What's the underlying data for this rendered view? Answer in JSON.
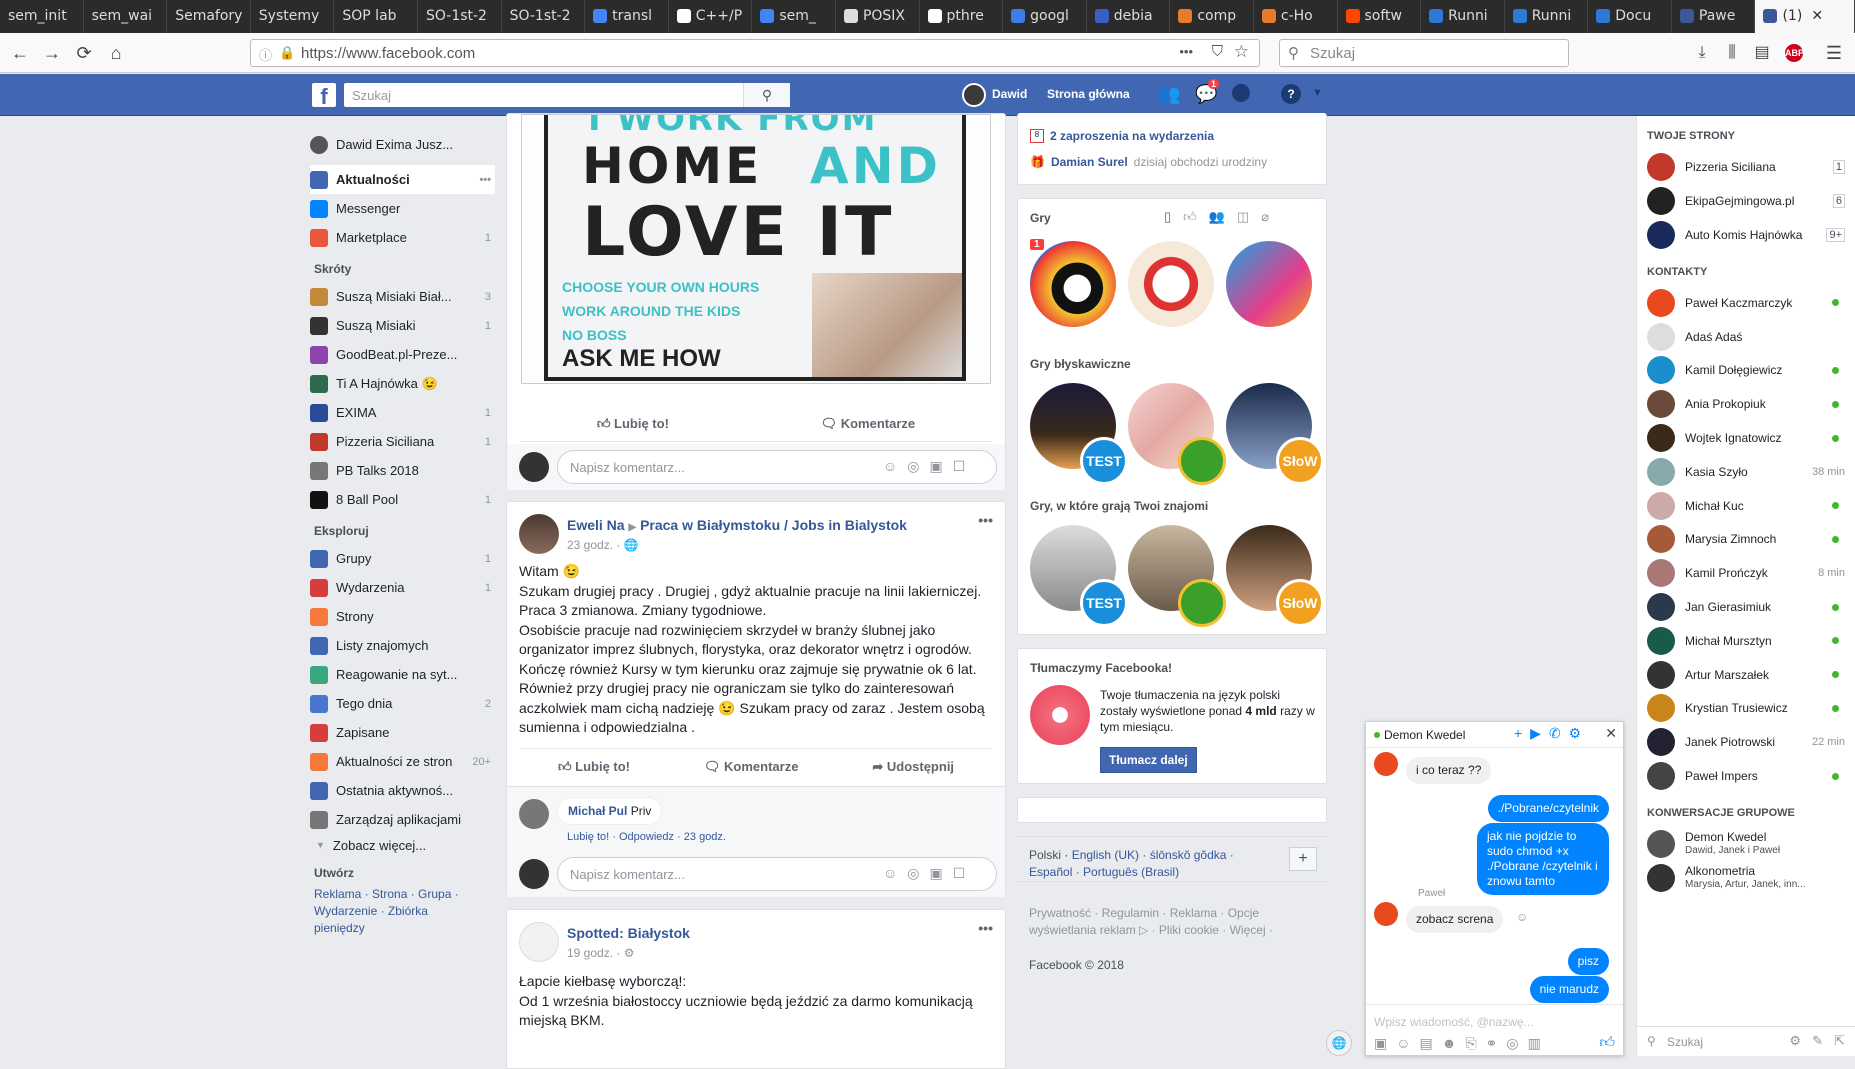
{
  "tabs": [
    {
      "label": "sem_init",
      "color": "#777"
    },
    {
      "label": "sem_wai",
      "color": "#777"
    },
    {
      "label": "Semafory",
      "color": "#777"
    },
    {
      "label": "Systemy",
      "color": "#777"
    },
    {
      "label": "SOP lab",
      "color": "#777"
    },
    {
      "label": "SO-1st-2",
      "color": "#777"
    },
    {
      "label": "SO-1st-2",
      "color": "#777"
    },
    {
      "label": "transl",
      "color": "#4285f4"
    },
    {
      "label": "C++/P",
      "color": "#fff"
    },
    {
      "label": "sem_",
      "color": "#4285f4"
    },
    {
      "label": "POSIX",
      "color": "#ddd"
    },
    {
      "label": "pthre",
      "color": "#fff"
    },
    {
      "label": "googl",
      "color": "#3f7ee8"
    },
    {
      "label": "debia",
      "color": "#3b5fc4"
    },
    {
      "label": "comp",
      "color": "#e87a2b"
    },
    {
      "label": "c-Ho",
      "color": "#e87a2b"
    },
    {
      "label": "softw",
      "color": "#ff4500"
    },
    {
      "label": "Runni",
      "color": "#2a7ad6"
    },
    {
      "label": "Runni",
      "color": "#2a7ad6"
    },
    {
      "label": "Docu",
      "color": "#2a7ad6"
    },
    {
      "label": "Pawe",
      "color": "#3b5998"
    }
  ],
  "active_tab": {
    "label": "(1)",
    "close": "✕"
  },
  "browser": {
    "url": "https://www.facebook.com",
    "search_placeholder": "Szukaj",
    "back": "←",
    "forward": "→",
    "reload": "⟳",
    "home": "⌂",
    "more": "•••",
    "star": "☆",
    "menu": "☰",
    "adblock_count": "1"
  },
  "fb": {
    "search_placeholder": "Szukaj",
    "logo": "f",
    "user": "Dawid",
    "home": "Strona główna",
    "msg_badge": "1",
    "left": {
      "profile": "Dawid Exima Jusz...",
      "items": [
        {
          "label": "Aktualności",
          "count": "•••",
          "color": "#4267b2"
        },
        {
          "label": "Messenger",
          "count": "",
          "color": "#0084ff"
        },
        {
          "label": "Marketplace",
          "count": "1",
          "color": "#e9573f"
        }
      ],
      "shortcuts_head": "Skróty",
      "shortcuts": [
        {
          "label": "Suszą Misiaki Biał...",
          "count": "3",
          "color": "#c48a3a"
        },
        {
          "label": "Suszą Misiaki",
          "count": "1",
          "color": "#333"
        },
        {
          "label": "GoodBeat.pl-Preze...",
          "count": "",
          "color": "#8e44ad"
        },
        {
          "label": "Ti A Hajnówka 😉",
          "count": "",
          "color": "#2d6a4f"
        },
        {
          "label": "EXIMA",
          "count": "1",
          "color": "#2a4a9a"
        },
        {
          "label": "Pizzeria Siciliana",
          "count": "1",
          "color": "#c0392b"
        },
        {
          "label": "PB Talks 2018",
          "count": "",
          "color": "#777"
        },
        {
          "label": "8 Ball Pool",
          "count": "1",
          "color": "#111"
        }
      ],
      "explore_head": "Eksploruj",
      "explore": [
        {
          "label": "Grupy",
          "count": "1",
          "color": "#4267b2"
        },
        {
          "label": "Wydarzenia",
          "count": "1",
          "color": "#d63d3d"
        },
        {
          "label": "Strony",
          "count": "",
          "color": "#f5793a"
        },
        {
          "label": "Listy znajomych",
          "count": "",
          "color": "#4267b2"
        },
        {
          "label": "Reagowanie na syt...",
          "count": "",
          "color": "#3aa77e"
        },
        {
          "label": "Tego dnia",
          "count": "2",
          "color": "#4a76d0"
        },
        {
          "label": "Zapisane",
          "count": "",
          "color": "#d63d3d"
        },
        {
          "label": "Aktualności ze stron",
          "count": "20+",
          "color": "#f5793a"
        },
        {
          "label": "Ostatnia aktywnoś...",
          "count": "",
          "color": "#4267b2"
        },
        {
          "label": "Zarządzaj aplikacjami",
          "count": "",
          "color": "#777"
        }
      ],
      "see_more": "Zobacz więcej...",
      "create_head": "Utwórz",
      "create_links": "Reklama · Strona · Grupa · Wydarzenie · Zbiórka pieniędzy"
    },
    "post1": {
      "img_line1": "I WORK FROM",
      "img_line2a": "HOME",
      "img_line2b": "AND",
      "img_line3": "LOVE IT",
      "img_small1": "CHOOSE YOUR OWN HOURS",
      "img_small2": "WORK AROUND THE KIDS",
      "img_small3": "NO BOSS",
      "img_cta": "ASK ME HOW",
      "like": "Lubię to!",
      "comment": "Komentarze",
      "comment_placeholder": "Napisz komentarz..."
    },
    "post2": {
      "author": "Eweli Na",
      "arrow": "▶",
      "group": "Praca w Białymstoku / Jobs in Bialystok",
      "time": "23 godz. · 🌐",
      "text1": "Witam 😉",
      "text2": "Szukam drugiej pracy . Drugiej , gdyż aktualnie pracuje na linii lakierniczej.",
      "text3": "Praca 3 zmianowa. Zmiany tygodniowe.",
      "text4": "Osobiście pracuje nad rozwinięciem skrzydeł w branży ślubnej jako",
      "text5": "organizator imprez ślubnych, florystyka, oraz dekorator wnętrz i ogrodów.",
      "text6": "Kończę również Kursy w tym kierunku oraz zajmuje się prywatnie ok 6 lat.",
      "text7": "Również przy drugiej pracy nie ograniczam sie tylko do zainteresowań",
      "text8": "aczkolwiek mam cichą nadzieję 😉 Szukam pracy od zaraz . Jestem osobą",
      "text9": "sumienna i odpowiedzialna .",
      "like": "Lubię to!",
      "comment": "Komentarze",
      "share": "Udostępnij",
      "c_author": "Michał Pul",
      "c_text": "Priv",
      "c_actions": "Lubię to! · Odpowiedz · 23 godz.",
      "comment_placeholder": "Napisz komentarz..."
    },
    "post3": {
      "author": "Spotted: Białystok",
      "time": "19 godz. · ⚙",
      "text1": "Łapcie kiełbasę wyborczą!:",
      "text2": "Od 1 września białostoccy uczniowie będą jeździć za darmo komunikacją",
      "text3": "miejską BKM."
    },
    "right": {
      "events": "2 zaproszenia na wydarzenia",
      "bday_name": "Damian Surel",
      "bday_text": "dzisiaj obchodzi urodziny",
      "games_head": "Gry",
      "games_badge": "1",
      "instant_head": "Gry błyskawiczne",
      "friends_games_head": "Gry, w które grają Twoi znajomi",
      "test": "TEST",
      "slow": "SłoW",
      "translate_head": "Tłumaczymy Facebooka!",
      "translate_text1": "Twoje tłumaczenia na język polski",
      "translate_text2": "zostały wyświetlone ponad",
      "translate_bold": "4 mld",
      "translate_text3": "razy w tym miesiącu.",
      "translate_btn": "Tłumacz dalej",
      "langs_current": "Polski",
      "langs": "English (UK) · ślōnskŏ gŏdka · Español · Português (Brasil)",
      "plus": "+",
      "footer": "Prywatność · Regulamin · Reklama · Opcje wyświetlania reklam ▷ · Pliki cookie · Więcej ·",
      "copyright": "Facebook © 2018"
    },
    "sidebar": {
      "pages_head": "TWOJE STRONY",
      "pages": [
        {
          "name": "Pizzeria Siciliana",
          "count": "1",
          "color": "#c0392b"
        },
        {
          "name": "EkipaGejmingowa.pl",
          "count": "6",
          "color": "#222"
        },
        {
          "name": "Auto Komis Hajnówka",
          "count": "9+",
          "color": "#1a2a5a"
        }
      ],
      "contacts_head": "KONTAKTY",
      "contacts": [
        {
          "name": "Paweł Kaczmarczyk",
          "time": "",
          "online": true,
          "color": "#e8491d"
        },
        {
          "name": "Adaś Adaś",
          "time": "",
          "online": false,
          "color": "#ddd"
        },
        {
          "name": "Kamil Dołęgiewicz",
          "time": "",
          "online": true,
          "color": "#1a8fcc"
        },
        {
          "name": "Ania Prokopiuk",
          "time": "",
          "online": true,
          "color": "#6b4a3a"
        },
        {
          "name": "Wojtek Ignatowicz",
          "time": "",
          "online": true,
          "color": "#3a2a1a"
        },
        {
          "name": "Kasia Szyło",
          "time": "38 min",
          "online": false,
          "color": "#8aa"
        },
        {
          "name": "Michał Kuc",
          "time": "",
          "online": true,
          "color": "#caa"
        },
        {
          "name": "Marysia Zimnoch",
          "time": "",
          "online": true,
          "color": "#a55a3a"
        },
        {
          "name": "Kamil Prończyk",
          "time": "8 min",
          "online": false,
          "color": "#a77"
        },
        {
          "name": "Jan Gierasimiuk",
          "time": "",
          "online": true,
          "color": "#2a3a4a"
        },
        {
          "name": "Michał Mursztyn",
          "time": "",
          "online": true,
          "color": "#1a5a4a"
        },
        {
          "name": "Artur Marszałek",
          "time": "",
          "online": true,
          "color": "#333"
        },
        {
          "name": "Krystian Trusiewicz",
          "time": "",
          "online": true,
          "color": "#c8861a"
        },
        {
          "name": "Janek Piotrowski",
          "time": "22 min",
          "online": false,
          "color": "#223"
        },
        {
          "name": "Paweł Impers",
          "time": "",
          "online": true,
          "color": "#444"
        }
      ],
      "groups_head": "KONWERSACJE GRUPOWE",
      "groups": [
        {
          "name": "Demon Kwedel",
          "sub": "Dawid, Janek i Paweł",
          "color": "#555"
        },
        {
          "name": "Alkonometria",
          "sub": "Marysia, Artur, Janek, inn...",
          "color": "#333"
        }
      ],
      "search": "Szukaj"
    },
    "chat": {
      "title": "Demon Kwedel",
      "m1": "i co teraz ??",
      "m2": "./Pobrane/czytelnik",
      "m3": "jak nie pojdzie to sudo chmod +x ./Pobrane /czytelnik i znowu tamto",
      "sender": "Paweł",
      "m4": "zobacz screna",
      "m5": "pisz",
      "m6": "nie marudz",
      "placeholder": "Wpisz wiadomość, @nazwę..."
    }
  }
}
